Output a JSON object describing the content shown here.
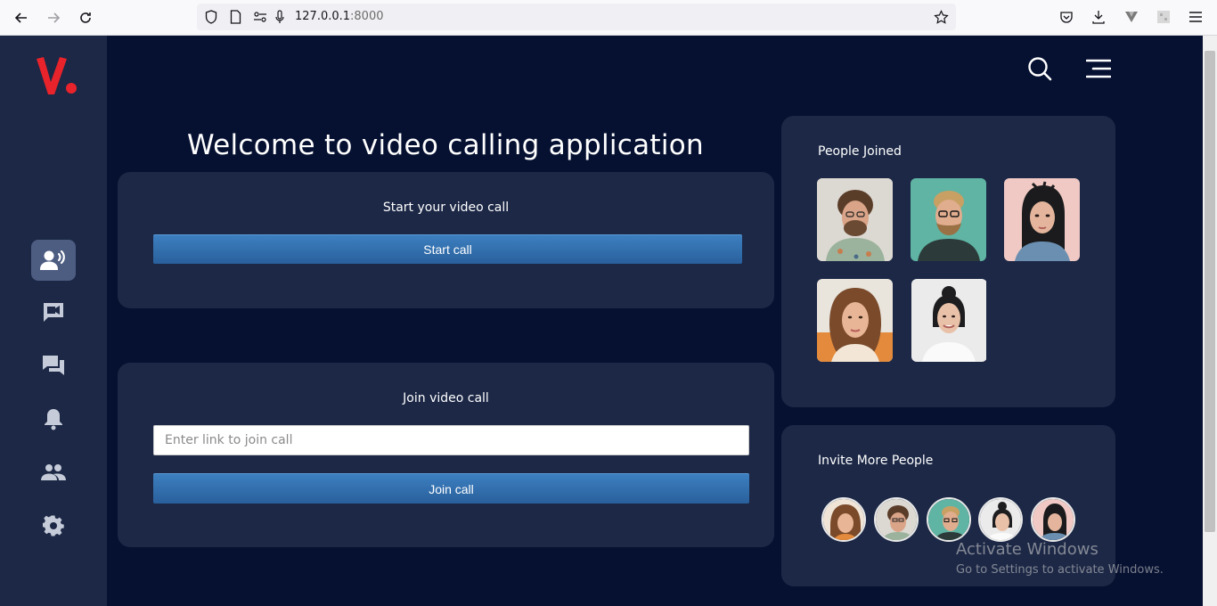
{
  "browser": {
    "url_host": "127.0.0.1",
    "url_port": ":8000"
  },
  "colors": {
    "sidebar": "#1c2846",
    "main_bg": "#061131",
    "card_bg": "#1c2846",
    "button": "#2e6aa8",
    "logo_red": "#e8232b"
  },
  "sidebar": {
    "items": [
      {
        "icon": "audio-call-icon",
        "active": true
      },
      {
        "icon": "video-chat-icon",
        "active": false
      },
      {
        "icon": "chat-icon",
        "active": false
      },
      {
        "icon": "bell-icon",
        "active": false
      },
      {
        "icon": "people-icon",
        "active": false
      },
      {
        "icon": "gear-icon",
        "active": false
      }
    ]
  },
  "header": {
    "icons": [
      "search-icon",
      "menu-icon"
    ]
  },
  "main": {
    "welcome_title": "Welcome to video calling application",
    "start_card": {
      "title": "Start your video call",
      "button_label": "Start call"
    },
    "join_card": {
      "title": "Join video call",
      "input_placeholder": "Enter link to join call",
      "input_value": "",
      "button_label": "Join call"
    }
  },
  "people_joined": {
    "title": "People Joined",
    "people": [
      {
        "name": "person-1"
      },
      {
        "name": "person-2"
      },
      {
        "name": "person-3"
      },
      {
        "name": "person-4"
      },
      {
        "name": "person-5"
      }
    ]
  },
  "invite": {
    "title": "Invite More People",
    "avatars": [
      "avatar-1",
      "avatar-2",
      "avatar-3",
      "avatar-4",
      "avatar-5"
    ]
  },
  "watermark": {
    "title": "Activate Windows",
    "subtitle": "Go to Settings to activate Windows."
  }
}
